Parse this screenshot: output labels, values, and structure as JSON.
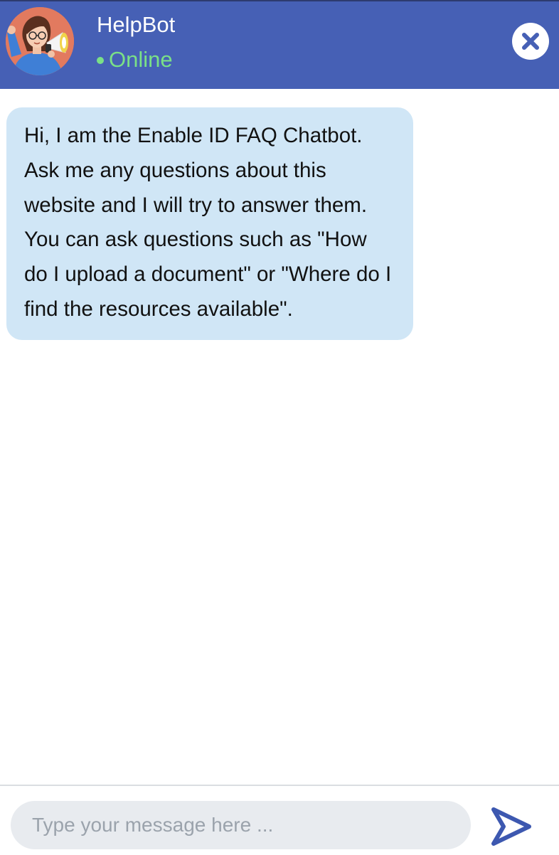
{
  "header": {
    "bot_name": "HelpBot",
    "status_label": "Online",
    "avatar_icon": "woman-with-megaphone-avatar",
    "close_icon": "close-icon",
    "background_color": "#4660b5",
    "status_color": "#7ae087"
  },
  "messages": [
    {
      "sender": "bot",
      "text": "Hi, I am the Enable ID FAQ Chatbot. Ask me any questions about this website and I will try to answer them. You can ask questions such as \"How do I upload a document\" or \"Where do I find the resources available\".",
      "bubble_color": "#d0e6f6"
    }
  ],
  "composer": {
    "placeholder": "Type your message here ...",
    "value": "",
    "send_icon": "send-arrow-icon"
  }
}
